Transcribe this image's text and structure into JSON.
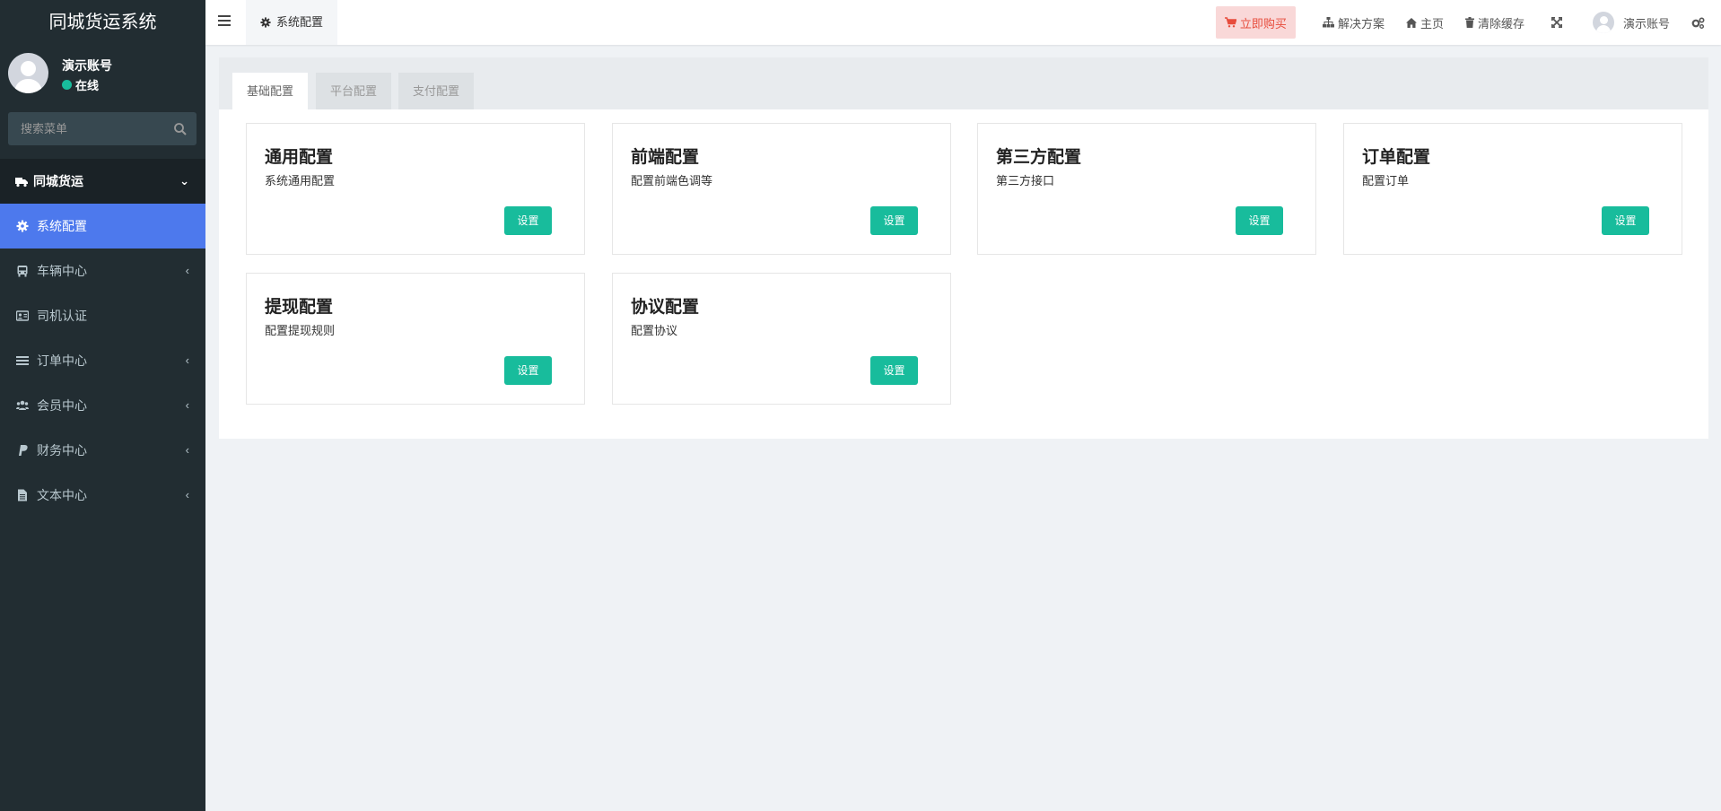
{
  "sidebar": {
    "brand": "同城货运系统",
    "user_name": "演示账号",
    "user_status": "在线",
    "search_placeholder": "搜索菜单",
    "menu": [
      {
        "label": "同城货运",
        "icon": "truck-icon",
        "type": "header"
      },
      {
        "label": "系统配置",
        "icon": "gear-icon",
        "type": "active"
      },
      {
        "label": "车辆中心",
        "icon": "bus-icon",
        "type": "expandable"
      },
      {
        "label": "司机认证",
        "icon": "id-card-icon",
        "type": "plain"
      },
      {
        "label": "订单中心",
        "icon": "list-icon",
        "type": "expandable"
      },
      {
        "label": "会员中心",
        "icon": "users-icon",
        "type": "expandable"
      },
      {
        "label": "财务中心",
        "icon": "paypal-icon",
        "type": "expandable"
      },
      {
        "label": "文本中心",
        "icon": "file-icon",
        "type": "expandable"
      }
    ]
  },
  "topbar": {
    "open_tab": "系统配置",
    "buy": "立即购买",
    "solutions": "解决方案",
    "home": "主页",
    "clear_cache": "清除缓存",
    "account": "演示账号"
  },
  "tabs": [
    "基础配置",
    "平台配置",
    "支付配置"
  ],
  "cards": [
    {
      "title": "通用配置",
      "desc": "系统通用配置",
      "button": "设置"
    },
    {
      "title": "前端配置",
      "desc": "配置前端色调等",
      "button": "设置"
    },
    {
      "title": "第三方配置",
      "desc": "第三方接口",
      "button": "设置"
    },
    {
      "title": "订单配置",
      "desc": "配置订单",
      "button": "设置"
    },
    {
      "title": "提现配置",
      "desc": "配置提现规则",
      "button": "设置"
    },
    {
      "title": "协议配置",
      "desc": "配置协议",
      "button": "设置"
    }
  ],
  "colors": {
    "sidebar_bg": "#222d32",
    "active_menu": "#4d79ed",
    "accent_green": "#18bc9c",
    "buy_bg": "#f9d8d8",
    "buy_text": "#e74c3c"
  }
}
